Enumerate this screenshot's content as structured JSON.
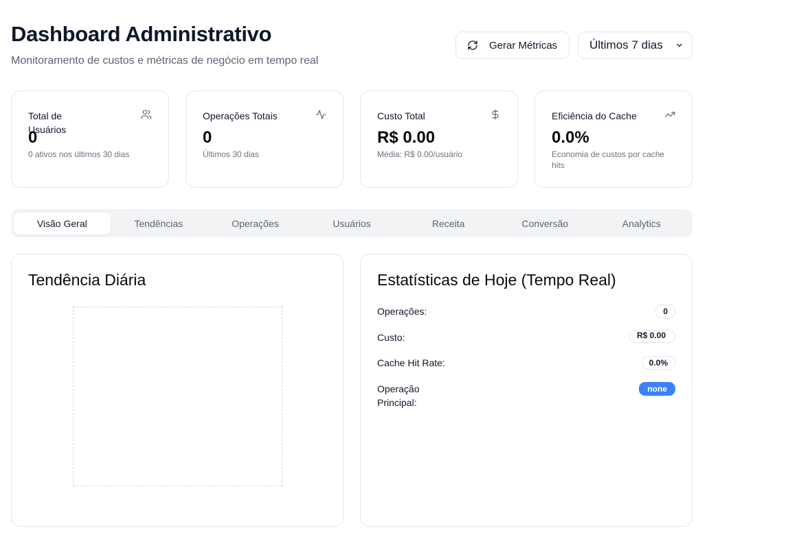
{
  "header": {
    "title": "Dashboard Administrativo",
    "subtitle": "Monitoramento de custos e métricas de negócio em tempo real"
  },
  "actions": {
    "generate_label": "Gerar Métricas",
    "period_selected": "Últimos 7 dias"
  },
  "cards": [
    {
      "title": "Total de Usuários",
      "icon": "users-icon",
      "value": "0",
      "sub": "0 ativos nos últimos 30 dias"
    },
    {
      "title": "Operações Totais",
      "icon": "activity-icon",
      "value": "0",
      "sub": "Últimos 30 dias"
    },
    {
      "title": "Custo Total",
      "icon": "dollar-icon",
      "value": "R$ 0.00",
      "sub": "Média: R$ 0.00/usuário"
    },
    {
      "title": "Eficiência do Cache",
      "icon": "trending-up-icon",
      "value": "0.0%",
      "sub": "Economia de custos por cache hits"
    }
  ],
  "tabs": [
    "Visão Geral",
    "Tendências",
    "Operações",
    "Usuários",
    "Receita",
    "Conversão",
    "Analytics"
  ],
  "active_tab": "Visão Geral",
  "trend_panel": {
    "title": "Tendência Diária"
  },
  "today_panel": {
    "title": "Estatísticas de Hoje (Tempo Real)",
    "rows": [
      {
        "label": "Operações:",
        "value": "0"
      },
      {
        "label": "Custo:",
        "value": "R$ 0.00"
      },
      {
        "label": "Cache Hit Rate:",
        "value": "0.0%"
      },
      {
        "label": "Operação Principal:",
        "value": "none"
      }
    ]
  },
  "colors": {
    "accent": "#3b82f6",
    "border": "#e4e6eb",
    "muted": "#6b7280",
    "tab_bg": "#f1f3f5"
  }
}
